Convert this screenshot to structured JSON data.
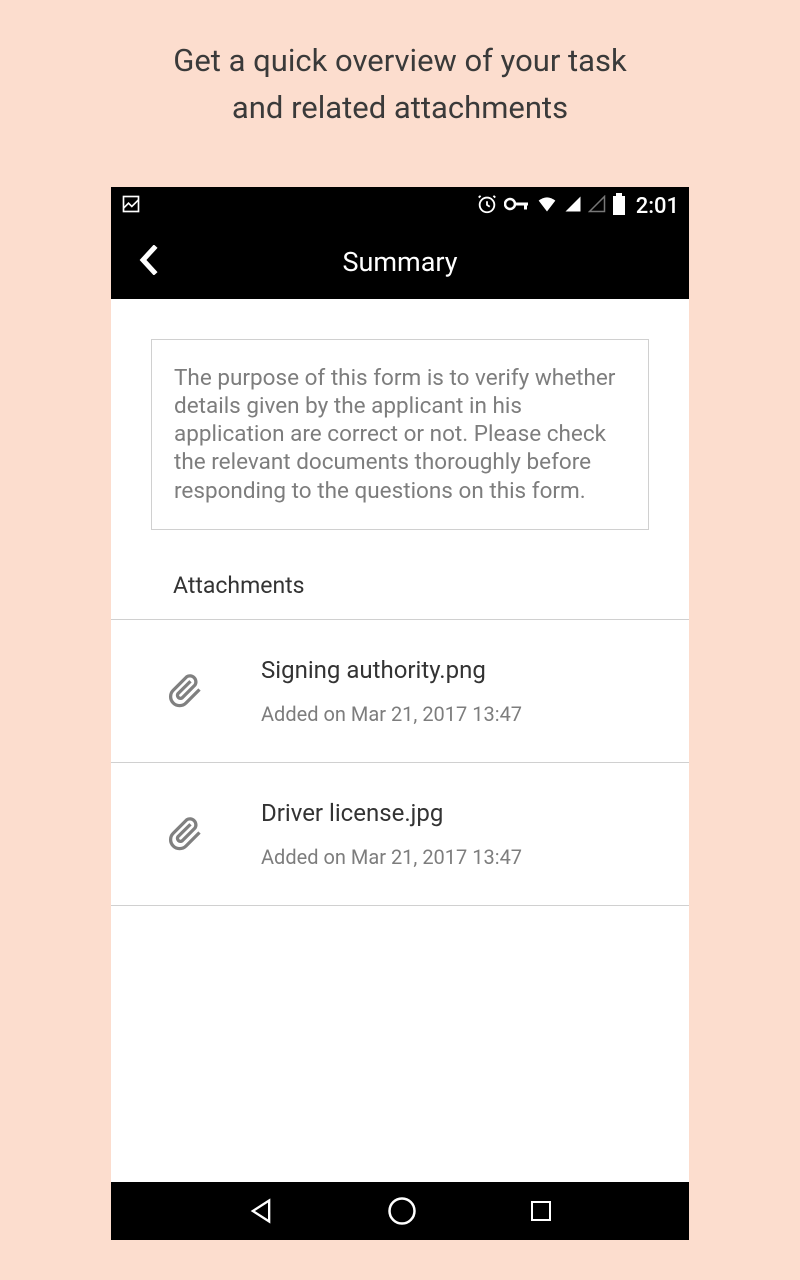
{
  "promo": {
    "line1": "Get a quick overview of your task",
    "line2": "and related attachments"
  },
  "status": {
    "time": "2:01"
  },
  "header": {
    "title": "Summary"
  },
  "description": "The purpose of this form is to verify whether details given by the applicant in his application are correct or not. Please check the relevant documents thoroughly before responding to the questions on this form.",
  "attachments": {
    "section_label": "Attachments",
    "items": [
      {
        "name": "Signing authority.png",
        "date": "Added on Mar 21, 2017 13:47"
      },
      {
        "name": "Driver license.jpg",
        "date": "Added on Mar 21, 2017 13:47"
      }
    ]
  }
}
